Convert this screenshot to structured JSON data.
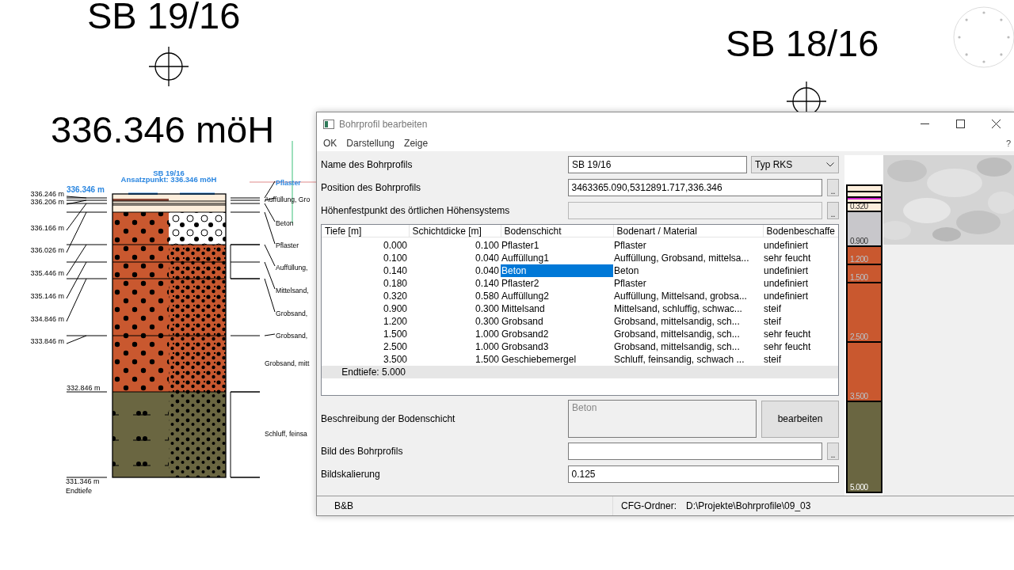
{
  "canvas_titles": [
    "SB 19/16",
    "336.346 möH",
    "SB 18/16"
  ],
  "profile_drawing": {
    "title": "SB 19/16",
    "subtitle": "Ansatzpunkt: 336.346 möH",
    "top_level": "336.346 m",
    "depth_labels": [
      "336.246 m",
      "336.206 m",
      "336.166 m",
      "336.026 m",
      "335.446 m",
      "335.146 m",
      "334.846 m",
      "333.846 m",
      "332.846 m",
      "331.346 m"
    ],
    "end_label": "Endtiefe",
    "layer_labels": [
      {
        "text": "Pflaster",
        "highlighted": true
      },
      {
        "text": "Auffüllung, Gro",
        "highlighted": false
      },
      {
        "text": "Beton",
        "highlighted": false
      },
      {
        "text": "Pflaster",
        "highlighted": false
      },
      {
        "text": "Auffüllung,",
        "highlighted": false
      },
      {
        "text": "Mittelsand,",
        "highlighted": false
      },
      {
        "text": "Grobsand,",
        "highlighted": false
      },
      {
        "text": "Grobsand,",
        "highlighted": false
      },
      {
        "text": "Grobsand, mitt",
        "highlighted": false
      },
      {
        "text": "Schluff, feinsa",
        "highlighted": false
      }
    ]
  },
  "dialog": {
    "title": "Bohrprofil bearbeiten",
    "menu": [
      "OK",
      "Darstellung",
      "Zeige"
    ],
    "help": "?",
    "name_field": {
      "label": "Name des Bohrprofils",
      "value": "SB 19/16",
      "type_select": "Typ RKS"
    },
    "position_field": {
      "label": "Position des Bohrprofils",
      "value": "3463365.090,5312891.717,336.346",
      "browse": ".."
    },
    "height_field": {
      "label": "Höhenfestpunkt des örtlichen Höhensystems",
      "disabled": true,
      "browse": ".."
    },
    "table": {
      "columns": [
        "Tiefe [m]",
        "Schichtdicke [m]",
        "Bodenschicht",
        "Bodenart / Material",
        "Bodenbeschaffe"
      ],
      "rows": [
        {
          "depth": "0.000",
          "thickness": "0.100",
          "layer": "Pflaster1",
          "material": "Pflaster",
          "condition": "undefiniert",
          "selected": false
        },
        {
          "depth": "0.100",
          "thickness": "0.040",
          "layer": "Auffüllung1",
          "material": "Auffüllung, Grobsand, mittelsa...",
          "condition": "sehr feucht",
          "selected": false
        },
        {
          "depth": "0.140",
          "thickness": "0.040",
          "layer": "Beton",
          "material": "Beton",
          "condition": "undefiniert",
          "selected": true
        },
        {
          "depth": "0.180",
          "thickness": "0.140",
          "layer": "Pflaster2",
          "material": "Pflaster",
          "condition": "undefiniert",
          "selected": false
        },
        {
          "depth": "0.320",
          "thickness": "0.580",
          "layer": "Auffüllung2",
          "material": "Auffüllung, Mittelsand, grobsa...",
          "condition": "undefiniert",
          "selected": false
        },
        {
          "depth": "0.900",
          "thickness": "0.300",
          "layer": "Mittelsand",
          "material": "Mittelsand, schluffig,  schwac...",
          "condition": "steif",
          "selected": false
        },
        {
          "depth": "1.200",
          "thickness": "0.300",
          "layer": "Grobsand",
          "material": "Grobsand, mittelsandig,  sch...",
          "condition": "steif",
          "selected": false
        },
        {
          "depth": "1.500",
          "thickness": "1.000",
          "layer": "Grobsand2",
          "material": "Grobsand, mittelsandig,  sch...",
          "condition": "sehr feucht",
          "selected": false
        },
        {
          "depth": "2.500",
          "thickness": "1.000",
          "layer": "Grobsand3",
          "material": "Grobsand, mittelsandig,  sch...",
          "condition": "sehr feucht",
          "selected": false
        },
        {
          "depth": "3.500",
          "thickness": "1.500",
          "layer": "Geschiebemergel",
          "material": "Schluff, feinsandig,  schwach ...",
          "condition": "steif",
          "selected": false
        }
      ],
      "footer": "Endtiefe: 5.000"
    },
    "description": {
      "label": "Beschreibung der Bodenschicht",
      "value": "Beton",
      "disabled": true,
      "button": "bearbeiten"
    },
    "image_field": {
      "label": "Bild des Bohrprofils",
      "browse": ".."
    },
    "scale_field": {
      "label": "Bildskalierung",
      "value": "0.125"
    },
    "profile_strip": {
      "layers": [
        {
          "color": "#fdeedc"
        },
        {
          "color": "#fdeedc"
        },
        {
          "color": "#fdeedc"
        },
        {
          "color": "#fdeedc",
          "label": "0.320"
        },
        {
          "color": "#c8c7cb",
          "label": "0.900"
        },
        {
          "color": "#c9582f",
          "label": "1.200"
        },
        {
          "color": "#c9582f",
          "label": "1.500"
        },
        {
          "color": "#c9582f",
          "label": "2.500"
        },
        {
          "color": "#c9582f",
          "label": "3.500"
        },
        {
          "color": "#6a6641",
          "label": "5.000"
        }
      ]
    },
    "status_bar": {
      "left": "B&B",
      "cfg_label": "CFG-Ordner:",
      "cfg_path": "D:\\Projekte\\Bohrprofile\\09_03"
    }
  }
}
